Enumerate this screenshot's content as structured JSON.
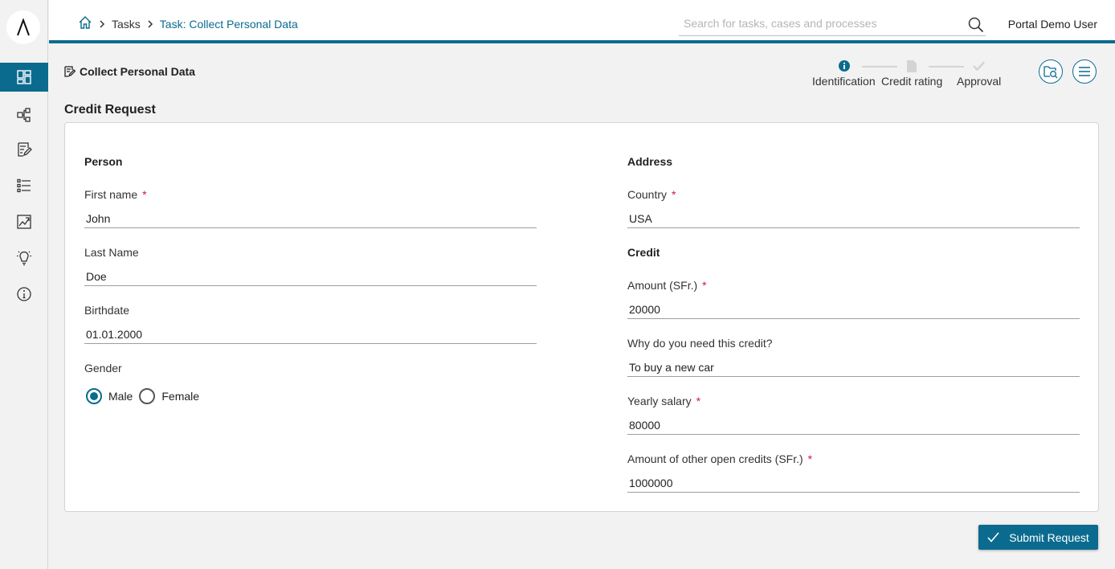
{
  "brand": {
    "accent": "#0b6b8f",
    "required": "#d0134c"
  },
  "sidebar": {
    "items": [
      {
        "icon": "dashboard-icon",
        "active": true
      },
      {
        "icon": "process-icon",
        "active": false
      },
      {
        "icon": "task-list-icon",
        "active": false
      },
      {
        "icon": "case-list-icon",
        "active": false
      },
      {
        "icon": "statistics-icon",
        "active": false
      },
      {
        "icon": "idea-icon",
        "active": false
      },
      {
        "icon": "info-icon",
        "active": false
      }
    ]
  },
  "header": {
    "breadcrumb": [
      "Tasks",
      "Task: Collect Personal Data"
    ],
    "search_placeholder": "Search for tasks, cases and processes",
    "user": "Portal Demo User"
  },
  "page": {
    "task_title": "Collect Personal Data",
    "section_title": "Credit Request"
  },
  "steps": [
    {
      "label": "Identification",
      "icon": "info-circle-icon",
      "state": "current"
    },
    {
      "label": "Credit rating",
      "icon": "document-icon",
      "state": "pending"
    },
    {
      "label": "Approval",
      "icon": "check-icon",
      "state": "pending"
    }
  ],
  "form": {
    "person": {
      "title": "Person",
      "first_name": {
        "label": "First name",
        "value": "John",
        "required": true
      },
      "last_name": {
        "label": "Last Name",
        "value": "Doe",
        "required": false
      },
      "birthdate": {
        "label": "Birthdate",
        "value": "01.01.2000",
        "required": false
      },
      "gender": {
        "label": "Gender",
        "options": [
          "Male",
          "Female"
        ],
        "selected": "Male"
      }
    },
    "address": {
      "title": "Address",
      "country": {
        "label": "Country",
        "value": "USA",
        "required": true
      }
    },
    "credit": {
      "title": "Credit",
      "amount": {
        "label": "Amount (SFr.)",
        "value": "20000",
        "required": true
      },
      "reason": {
        "label": "Why do you need this credit?",
        "value": "To buy a new car",
        "required": false
      },
      "salary": {
        "label": "Yearly salary",
        "value": "80000",
        "required": true
      },
      "other_credits": {
        "label": "Amount of other open credits (SFr.)",
        "value": "1000000",
        "required": true
      }
    }
  },
  "actions": {
    "submit": "Submit Request"
  },
  "required_marker": "*"
}
